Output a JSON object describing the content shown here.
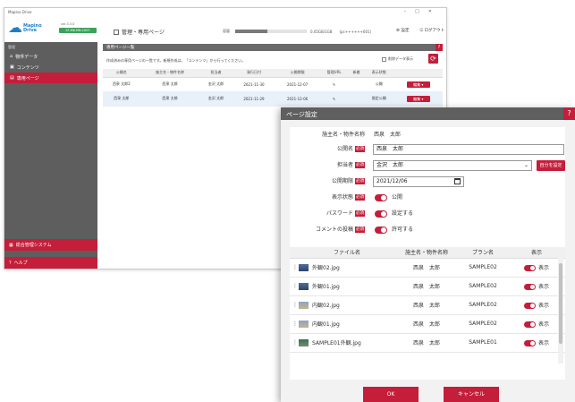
{
  "app": {
    "window_title": "Mapino Drive",
    "logo_text": "Mapino Drive",
    "version": "ver.3.3.0",
    "license": "ST-MK-MN-1007"
  },
  "header": {
    "breadcrumb": "管理・専用ページ",
    "capacity_label": "容量",
    "capacity_fraction": 0.45,
    "capacity_value": "0.05GB/1GB",
    "user": "(pc++++++001)",
    "settings": "設定",
    "logout": "ログアウト"
  },
  "sidebar": {
    "section": "管理",
    "items": [
      {
        "label": "物件データ",
        "icon": "home-icon"
      },
      {
        "label": "コンテンツ",
        "icon": "image-icon"
      },
      {
        "label": "専用ページ",
        "icon": "page-icon"
      }
    ],
    "system": "総合管理システム",
    "help": "ヘルプ"
  },
  "panel": {
    "title": "専用ページ一覧",
    "description": "作成済みの専用ページの一覧です。新規作成は、「コンテンツ」から行ってください。",
    "checkbox_label": "削除データ表示",
    "columns": [
      "公開名",
      "施主名・物件名称",
      "担当者",
      "発行日付",
      "公開期限",
      "管理URL",
      "新着",
      "表示状態",
      ""
    ],
    "rows": [
      {
        "public_name": "西泉 太郎2",
        "owner": "西泉 太郎",
        "staff": "金沢 太郎",
        "issued": "2021-11-30",
        "expiry": "2021-12-07",
        "new": "",
        "status": "公開",
        "edit": "編集"
      },
      {
        "public_name": "西泉 太郎",
        "owner": "西泉 太郎",
        "staff": "金沢 太郎",
        "issued": "2021-11-29",
        "expiry": "2021-12-06",
        "new": "",
        "status": "限定公開",
        "edit": "編集"
      }
    ]
  },
  "dialog": {
    "title": "ページ設定",
    "close": "?",
    "required": "必須",
    "owner_label": "施主名・物件名称",
    "owner_value": "西泉　太郎",
    "public_name_label": "公開名",
    "public_name_value": "西泉　太郎",
    "staff_label": "担当者",
    "staff_value": "金沢　太郎",
    "assign_self": "自分を設定",
    "expiry_label": "公開期限",
    "expiry_value": "2021/12/06",
    "display_label": "表示状態",
    "display_value": "公開",
    "password_label": "パスワード",
    "password_value": "設定する",
    "comment_label": "コメントの投稿",
    "comment_value": "許可する",
    "file_columns": [
      "",
      "ファイル名",
      "施主名・物件名称",
      "プラン名",
      "表示"
    ],
    "files": [
      {
        "name": "外観02.jpg",
        "owner": "西泉　太郎",
        "plan": "SAMPLE02",
        "show": "表示",
        "thumb": "exterior"
      },
      {
        "name": "外観01.jpg",
        "owner": "西泉　太郎",
        "plan": "SAMPLE02",
        "show": "表示",
        "thumb": "exterior"
      },
      {
        "name": "内観02.jpg",
        "owner": "西泉　太郎",
        "plan": "SAMPLE02",
        "show": "表示",
        "thumb": "interior"
      },
      {
        "name": "内観01.jpg",
        "owner": "西泉　太郎",
        "plan": "SAMPLE02",
        "show": "表示",
        "thumb": "interior"
      },
      {
        "name": "SAMPLE01外観.jpg",
        "owner": "西泉　太郎",
        "plan": "SAMPLE01",
        "show": "表示",
        "thumb": "sample"
      }
    ],
    "ok": "OK",
    "cancel": "キャンセル"
  },
  "colors": {
    "accent": "#c41e3a",
    "sidebar": "#5e5e5e",
    "header": "#6a6a6a"
  }
}
